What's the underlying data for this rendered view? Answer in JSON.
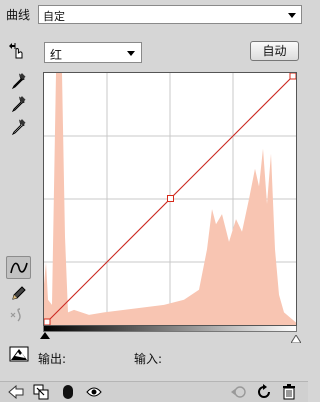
{
  "header": {
    "title": "曲线",
    "preset_value": "自定"
  },
  "channel": {
    "selected": "红",
    "auto_label": "自动"
  },
  "tools": [
    {
      "name": "on-image-adjust-icon"
    },
    {
      "name": "black-point-eyedropper-icon"
    },
    {
      "name": "gray-point-eyedropper-icon"
    },
    {
      "name": "white-point-eyedropper-icon"
    },
    {
      "name": "curve-point-tool-icon"
    },
    {
      "name": "pencil-draw-icon"
    },
    {
      "name": "smooth-curve-icon"
    }
  ],
  "curve": {
    "channel_color": "#d62a1a",
    "histogram_color": "#f8c5b2",
    "baseline_color": "#9b9bd6",
    "points": [
      [
        0,
        0
      ],
      [
        128,
        128
      ],
      [
        255,
        255
      ]
    ]
  },
  "io": {
    "output_label": "输出:",
    "input_label": "输入:"
  },
  "footer_icons": [
    "back-arrow-icon",
    "clip-to-layer-icon",
    "mask-icon",
    "visibility-eye-icon",
    "view-previous-state-icon",
    "reset-icon",
    "delete-trash-icon"
  ]
}
